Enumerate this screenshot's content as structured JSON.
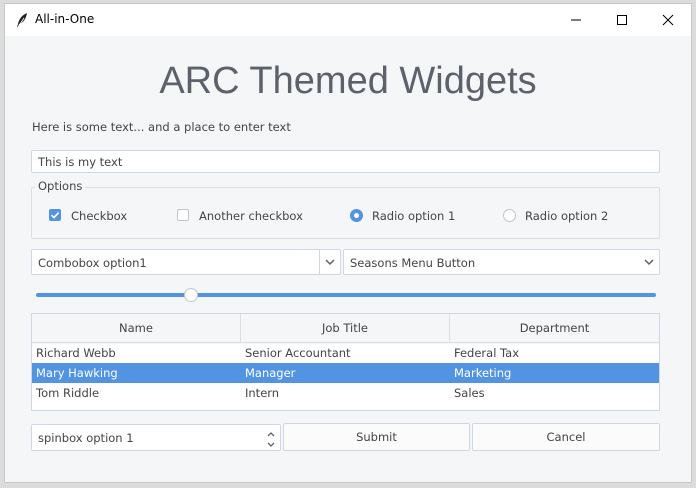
{
  "window": {
    "title": "All-in-One"
  },
  "heading": "ARC Themed Widgets",
  "intro_text": "Here is some text... and a place to enter text",
  "entry": {
    "value": "This is my text"
  },
  "options": {
    "label": "Options",
    "checkbox1": {
      "label": "Checkbox",
      "checked": true
    },
    "checkbox2": {
      "label": "Another checkbox",
      "checked": false
    },
    "radio1": {
      "label": "Radio option 1",
      "selected": true
    },
    "radio2": {
      "label": "Radio option 2",
      "selected": false
    }
  },
  "combobox": {
    "value": "Combobox option1"
  },
  "menubutton": {
    "label": "Seasons Menu Button"
  },
  "slider": {
    "value_fraction": 0.25
  },
  "table": {
    "columns": [
      "Name",
      "Job Title",
      "Department"
    ],
    "rows": [
      [
        "Richard Webb",
        "Senior Accountant",
        "Federal Tax"
      ],
      [
        "Mary Hawking",
        "Manager",
        "Marketing"
      ],
      [
        "Tom Riddle",
        "Intern",
        "Sales"
      ]
    ],
    "selected_row": 1
  },
  "spinbox": {
    "value": "spinbox option 1"
  },
  "buttons": {
    "submit": "Submit",
    "cancel": "Cancel"
  },
  "colors": {
    "accent": "#5294e2",
    "background": "#f5f6f7",
    "text": "#5c616c"
  },
  "icons": [
    "feather-icon",
    "minimize-icon",
    "maximize-icon",
    "close-icon",
    "chevron-down-icon",
    "check-icon",
    "spin-up-icon",
    "spin-down-icon"
  ]
}
